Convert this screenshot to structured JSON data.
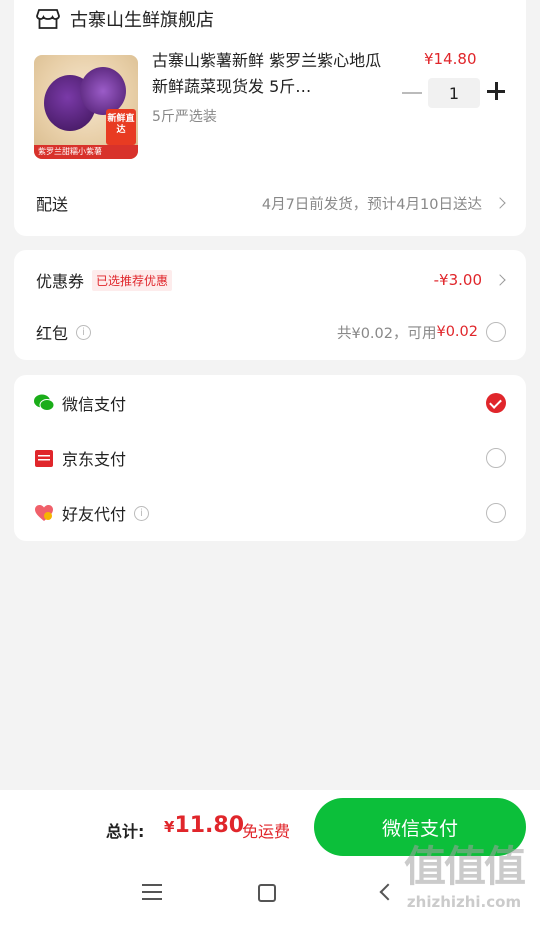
{
  "store": {
    "name": "古寨山生鲜旗舰店",
    "icon": "store-icon"
  },
  "product": {
    "title": "古寨山紫薯新鲜 紫罗兰紫心地瓜  新鲜蔬菜现货发 5斤…",
    "spec": "5斤严选装",
    "price": "¥14.80",
    "quantity": "1",
    "image": {
      "banner_text": "紫罗兰甜糯小紫薯",
      "badge_text": "新鲜直达"
    }
  },
  "delivery": {
    "label": "配送",
    "value": "4月7日前发货，预计4月10日送达"
  },
  "coupon": {
    "label": "优惠券",
    "tag": "已选推荐优惠",
    "value": "-¥3.00"
  },
  "red_packet": {
    "label": "红包",
    "total": "共¥0.02，可用",
    "available": "¥0.02"
  },
  "payment_methods": [
    {
      "label": "微信支付",
      "icon": "wechat-icon",
      "selected": true
    },
    {
      "label": "京东支付",
      "icon": "jd-pay-icon",
      "selected": false
    },
    {
      "label": "好友代付",
      "icon": "friend-pay-icon",
      "selected": false
    }
  ],
  "footer": {
    "total_label": "总计:",
    "currency": "¥",
    "total_amount": "11.80",
    "shipping": "免运费",
    "pay_button": "微信支付"
  },
  "watermark": {
    "main": "值值值",
    "sub": "zhizhizhi.com"
  },
  "colors": {
    "accent_red": "#e0262b",
    "wechat_green": "#0cbf3a"
  }
}
